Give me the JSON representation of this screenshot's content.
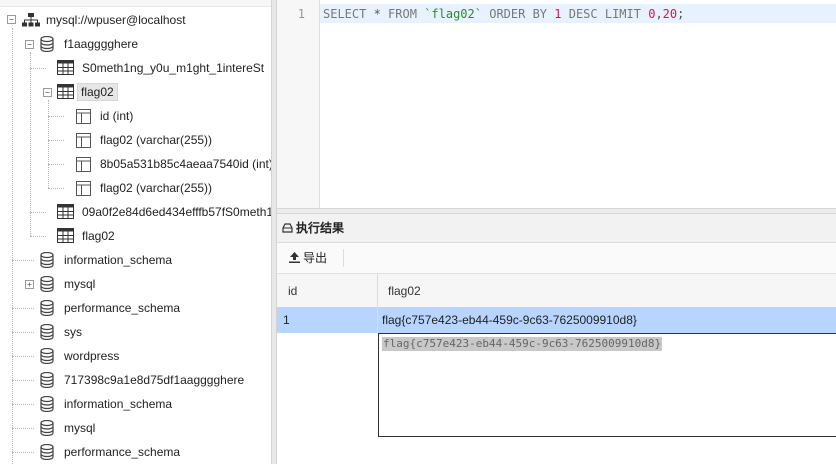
{
  "tree": {
    "connection": "mysql://wpuser@localhost",
    "databases": [
      {
        "name": "f1aagggghere",
        "expanded": true,
        "tables": [
          {
            "name": "S0meth1ng_y0u_m1ght_1intereSt"
          },
          {
            "name": "flag02",
            "expanded": true,
            "selected": true,
            "columns": [
              "id (int)",
              "flag02 (varchar(255))",
              "8b05a531b85c4aeaa7540id (int)",
              "flag02 (varchar(255))"
            ]
          },
          {
            "name": "09a0f2e84d6ed434efffb57fS0meth1ng"
          },
          {
            "name": "flag02"
          }
        ]
      },
      {
        "name": "information_schema"
      },
      {
        "name": "mysql",
        "collapsed_toggle": true
      },
      {
        "name": "performance_schema"
      },
      {
        "name": "sys"
      },
      {
        "name": "wordpress"
      },
      {
        "name": "717398c9a1e8d75df1aagggghere"
      },
      {
        "name": "information_schema"
      },
      {
        "name": "mysql"
      },
      {
        "name": "performance_schema"
      }
    ]
  },
  "editor": {
    "line_number": "1",
    "sql_tokens": {
      "select": "SELECT",
      "star": " * ",
      "from": "FROM",
      "space1": " ",
      "table": "`flag02`",
      "space2": " ",
      "order": "ORDER BY",
      "space3": " ",
      "one": "1",
      "space4": " ",
      "desc": "DESC LIMIT",
      "space5": " ",
      "zero": "0",
      "comma": ",",
      "twenty": "20",
      "semi": ";"
    }
  },
  "result": {
    "title": "执行结果",
    "export_label": "导出",
    "columns": [
      "id",
      "flag02"
    ],
    "rows": [
      {
        "id": "1",
        "flag02": "flag{c757e423-eb44-459c-9c63-7625009910d8}"
      }
    ],
    "cell_popup_text": "flag{c757e423-eb44-459c-9c63-7625009910d8}"
  }
}
